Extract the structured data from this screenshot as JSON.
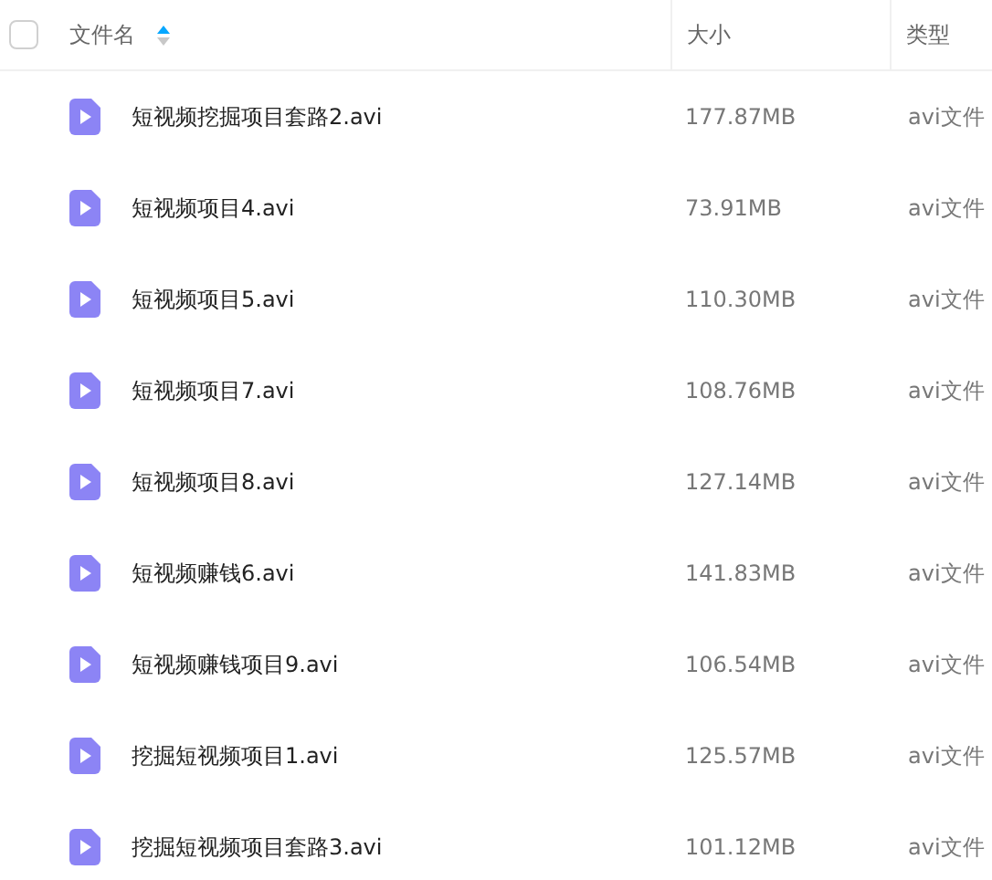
{
  "header": {
    "select_all": {
      "checked": false
    },
    "columns": [
      {
        "label": "文件名",
        "sorted": true
      },
      {
        "label": "大小",
        "sorted": false
      },
      {
        "label": "类型",
        "sorted": false
      }
    ]
  },
  "files": [
    {
      "name": "短视频挖掘项目套路2.avi",
      "size": "177.87MB",
      "type": "avi文件"
    },
    {
      "name": "短视频项目4.avi",
      "size": "73.91MB",
      "type": "avi文件"
    },
    {
      "name": "短视频项目5.avi",
      "size": "110.30MB",
      "type": "avi文件"
    },
    {
      "name": "短视频项目7.avi",
      "size": "108.76MB",
      "type": "avi文件"
    },
    {
      "name": "短视频项目8.avi",
      "size": "127.14MB",
      "type": "avi文件"
    },
    {
      "name": "短视频赚钱6.avi",
      "size": "141.83MB",
      "type": "avi文件"
    },
    {
      "name": "短视频赚钱项目9.avi",
      "size": "106.54MB",
      "type": "avi文件"
    },
    {
      "name": "挖掘短视频项目1.avi",
      "size": "125.57MB",
      "type": "avi文件"
    },
    {
      "name": "挖掘短视频项目套路3.avi",
      "size": "101.12MB",
      "type": "avi文件"
    }
  ]
}
